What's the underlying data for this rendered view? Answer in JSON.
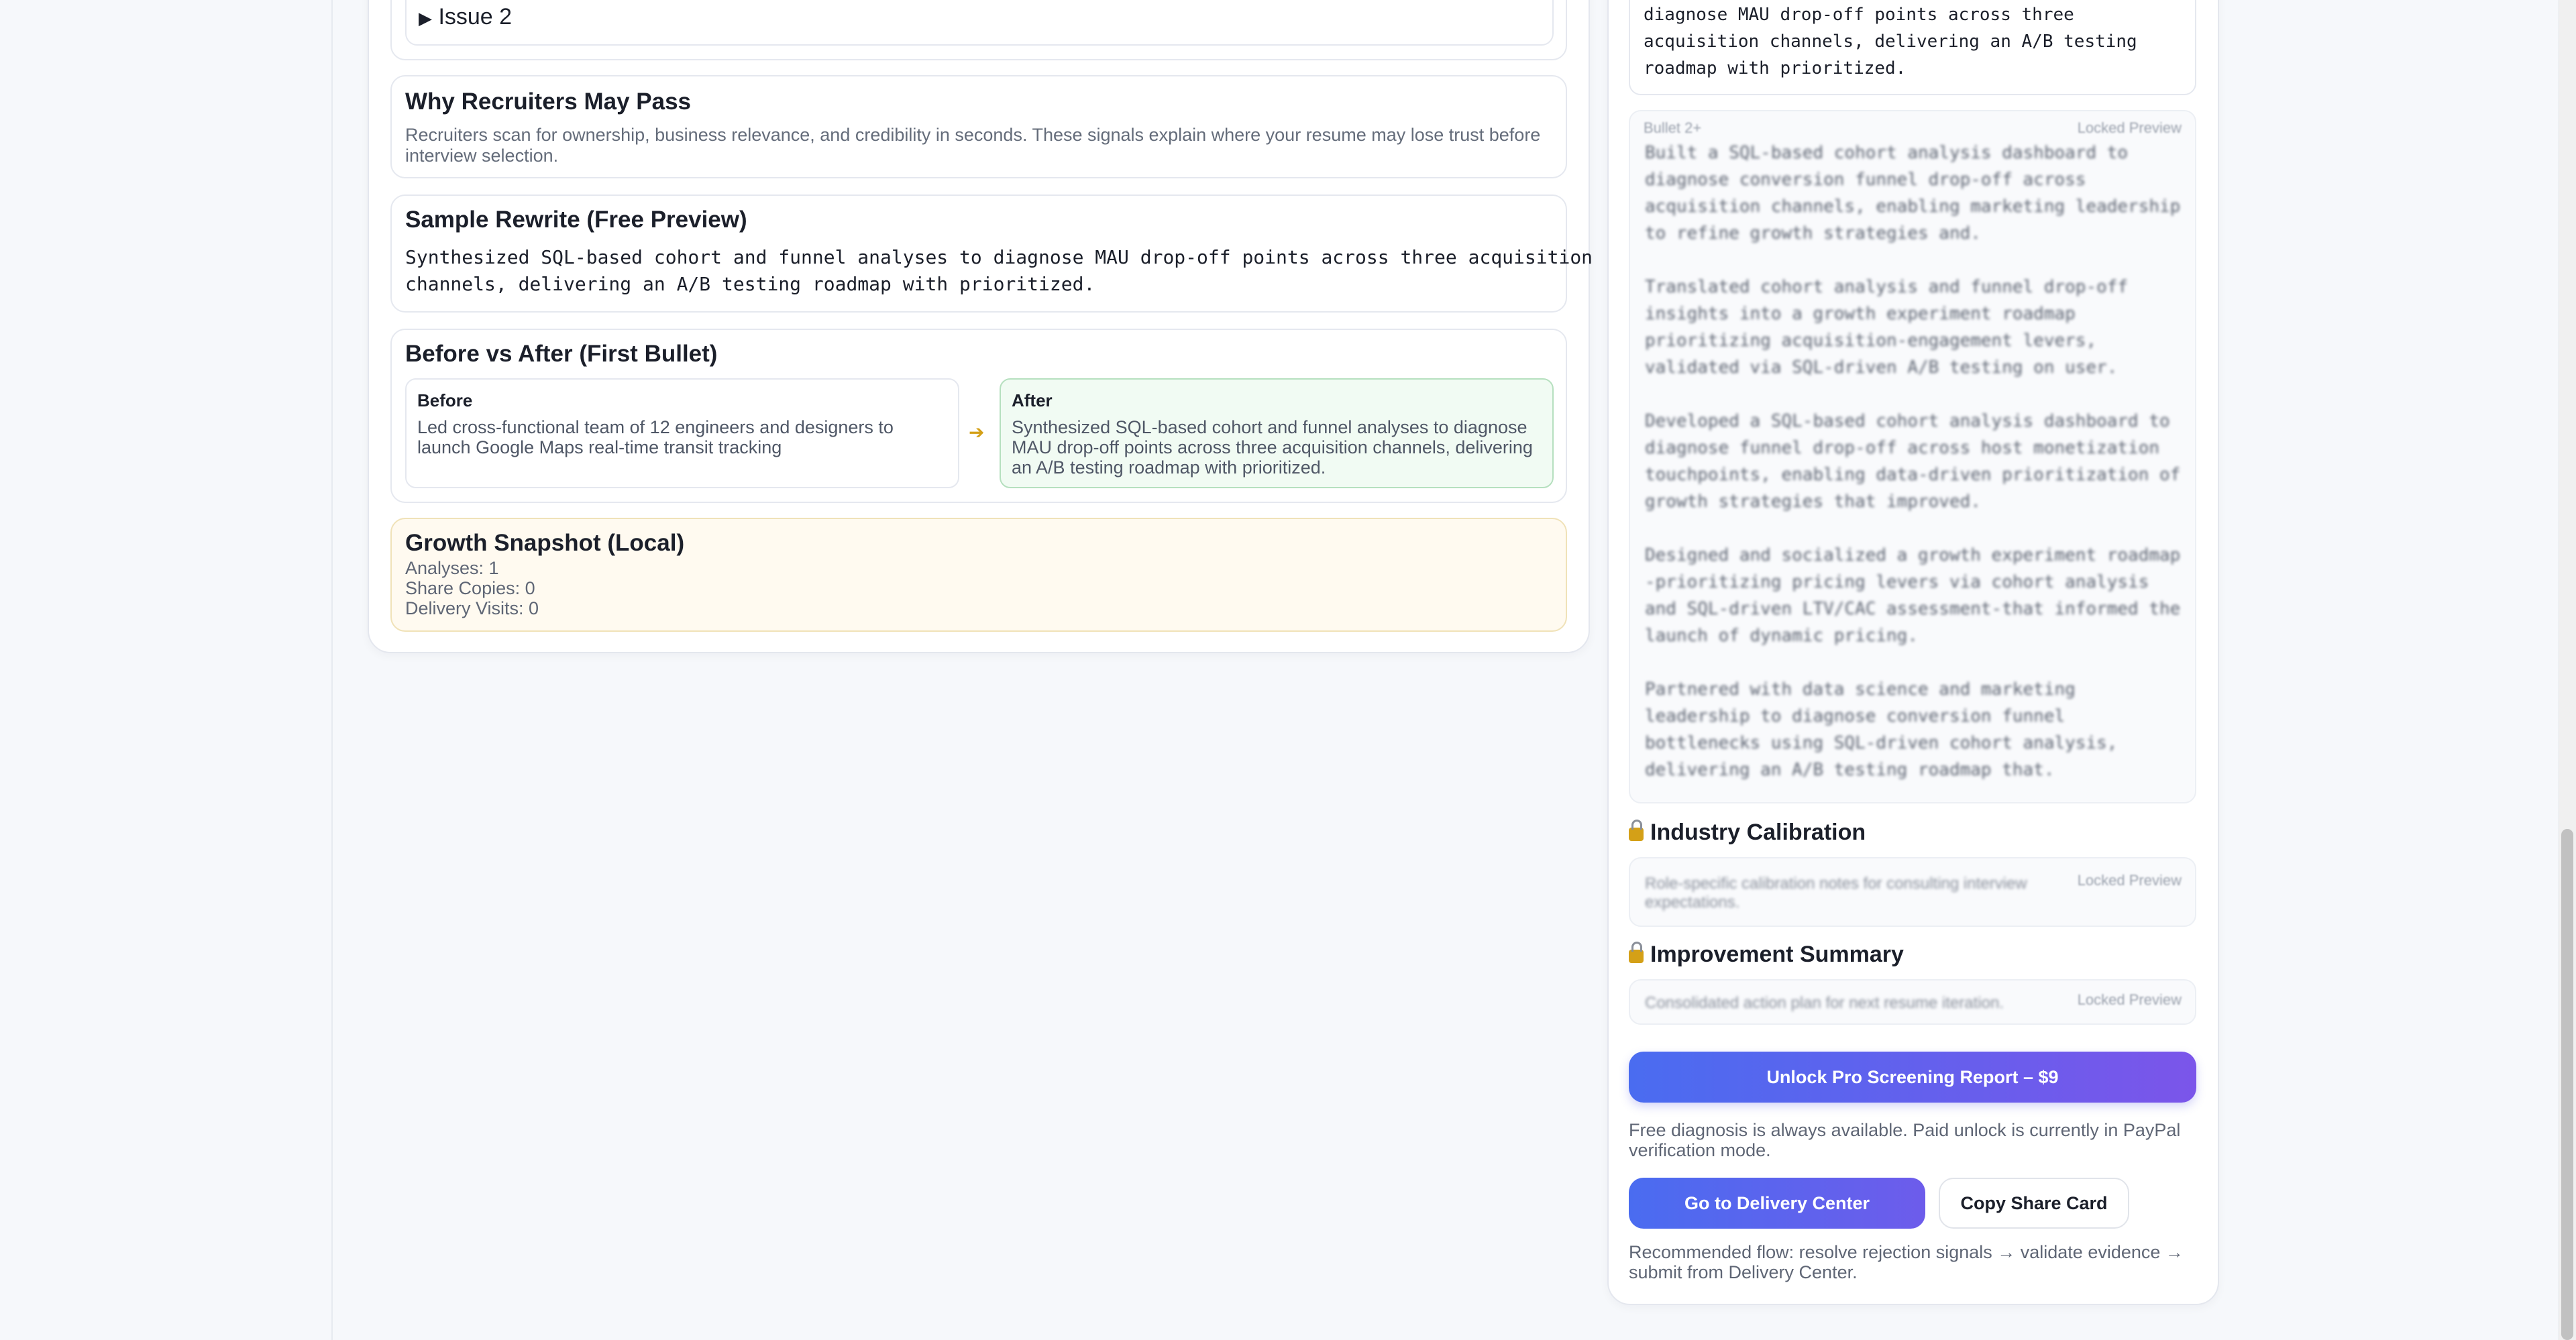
{
  "issue": {
    "label": "Issue 2",
    "caret": "▶"
  },
  "why": {
    "title": "Why Recruiters May Pass",
    "body": "Recruiters scan for ownership, business relevance, and credibility in seconds. These signals explain where your resume may lose trust before interview selection."
  },
  "sample": {
    "title": "Sample Rewrite (Free Preview)",
    "line1": "Synthesized SQL-based cohort and funnel analyses to diagnose MAU drop-off points across three acquisition",
    "line2": "channels, delivering an A/B testing roadmap with prioritized."
  },
  "compare": {
    "title": "Before vs After (First Bullet)",
    "before_label": "Before",
    "before_text": "Led cross-functional team of 12 engineers and designers to launch Google Maps real-time transit tracking",
    "arrow": "➔",
    "after_label": "After",
    "after_text": "Synthesized SQL-based cohort and funnel analyses to diagnose MAU drop-off points across three acquisition channels, delivering an A/B testing roadmap with prioritized."
  },
  "growth": {
    "title": "Growth Snapshot (Local)",
    "analyses": "Analyses: 1",
    "share_copies": "Share Copies: 0",
    "delivery_visits": "Delivery Visits: 0"
  },
  "side": {
    "top_lines": [
      "diagnose MAU drop-off points across three",
      "acquisition channels, delivering an A/B testing",
      "roadmap with prioritized."
    ],
    "locked": {
      "label": "Bullet 2+",
      "tag": "Locked Preview",
      "lines": [
        "Built a SQL-based cohort analysis dashboard to",
        "diagnose conversion funnel drop-off across",
        "acquisition channels, enabling marketing leadership",
        "to refine growth strategies and.",
        "",
        "Translated cohort analysis and funnel drop-off",
        "insights into a growth experiment roadmap",
        "prioritizing acquisition-engagement levers,",
        "validated via SQL-driven A/B testing on user.",
        "",
        "Developed a SQL-based cohort analysis dashboard to",
        "diagnose funnel drop-off across host monetization",
        "touchpoints, enabling data-driven prioritization of",
        "growth strategies that improved.",
        "",
        "Designed and socialized a growth experiment roadmap",
        "-prioritizing pricing levers via cohort analysis",
        "and SQL-driven LTV/CAC assessment-that informed the",
        "launch of dynamic pricing.",
        "",
        "Partnered with data science and marketing",
        "leadership to diagnose conversion funnel",
        "bottlenecks using SQL-driven cohort analysis,",
        "delivering an A/B testing roadmap that."
      ]
    },
    "industry": {
      "title": "Industry Calibration",
      "text": "Role-specific calibration notes for consulting interview expectations.",
      "tag": "Locked Preview"
    },
    "improvement": {
      "title": "Improvement Summary",
      "text": "Consolidated action plan for next resume iteration.",
      "tag": "Locked Preview"
    },
    "unlock_label": "Unlock Pro Screening Report – $9",
    "free_note": "Free diagnosis is always available. Paid unlock is currently in PayPal verification mode.",
    "delivery_label": "Go to Delivery Center",
    "share_label": "Copy Share Card",
    "flow_note": "Recommended flow: resolve rejection signals → validate evidence → submit from Delivery Center."
  }
}
